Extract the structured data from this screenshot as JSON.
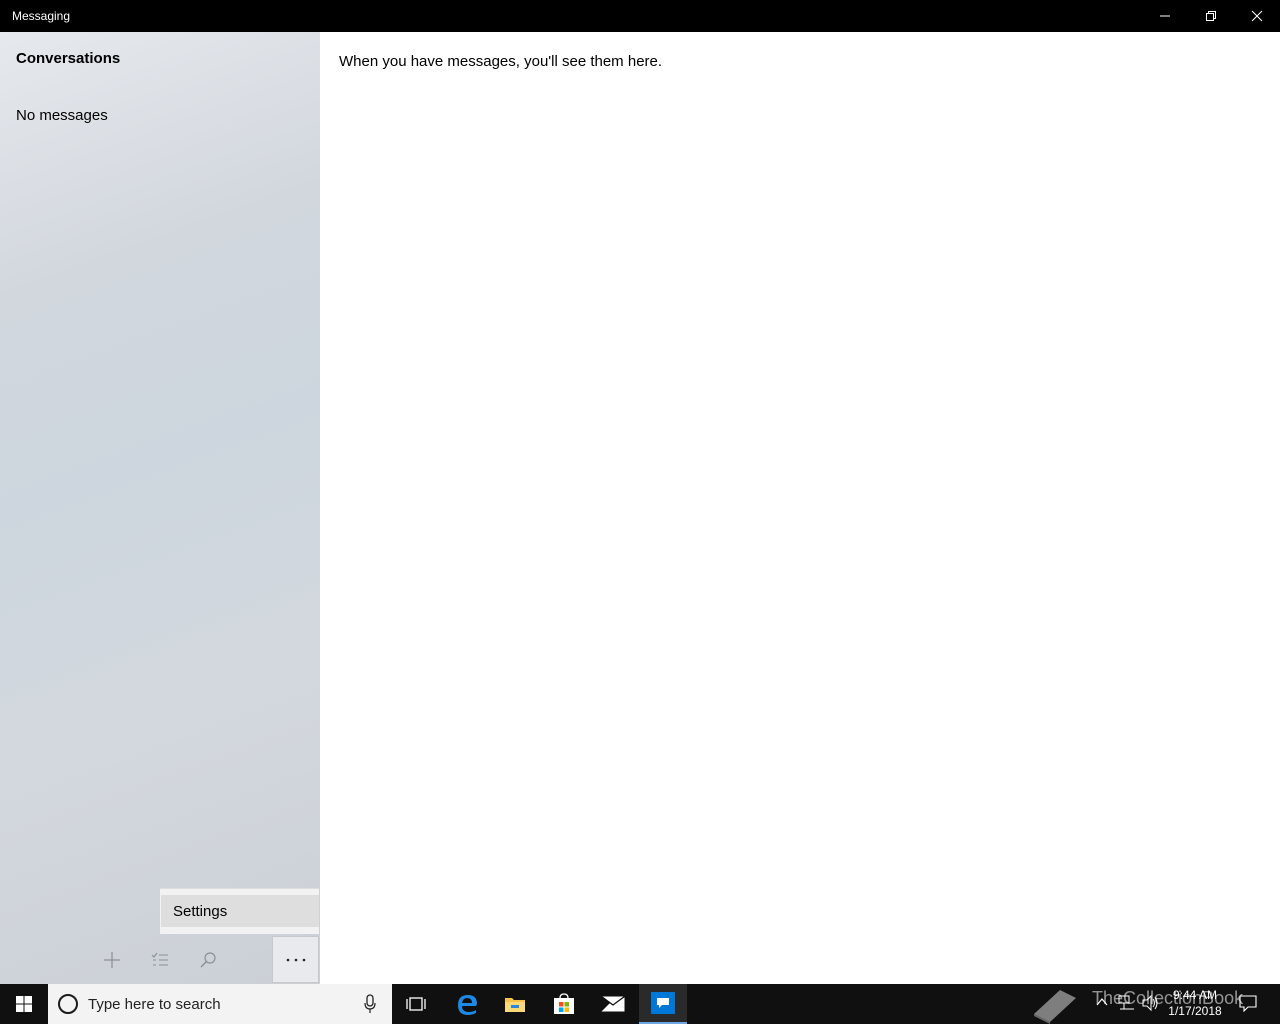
{
  "window": {
    "title": "Messaging",
    "controls": [
      "minimize-icon",
      "restore-icon",
      "close-icon"
    ]
  },
  "sidebar": {
    "title": "Conversations",
    "empty_text": "No messages"
  },
  "menu": {
    "items": [
      {
        "label": "Settings"
      }
    ]
  },
  "command_bar": {
    "icons": [
      "add-icon",
      "select-list-icon",
      "search-icon",
      "more-icon"
    ]
  },
  "main": {
    "empty_message": "When you have messages, you'll see them here."
  },
  "taskbar": {
    "search_placeholder": "Type here to search",
    "apps": [
      "task-view-icon",
      "edge-icon",
      "file-explorer-icon",
      "store-icon",
      "mail-icon",
      "messaging-icon"
    ],
    "time": "9:44 AM",
    "date": "1/17/2018",
    "watermark": "TheCollectionBook",
    "accent": "#0078d7"
  }
}
